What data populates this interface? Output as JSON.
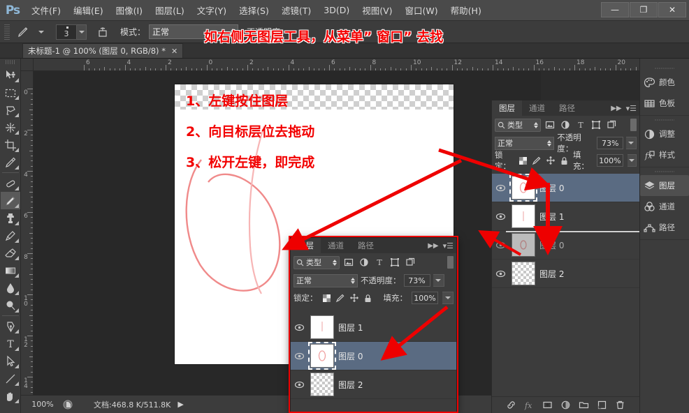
{
  "app": {
    "logo": "Ps"
  },
  "menubar": {
    "items": [
      {
        "label": "文件(F)"
      },
      {
        "label": "编辑(E)"
      },
      {
        "label": "图像(I)"
      },
      {
        "label": "图层(L)"
      },
      {
        "label": "文字(Y)"
      },
      {
        "label": "选择(S)"
      },
      {
        "label": "滤镜(T)"
      },
      {
        "label": "3D(D)"
      },
      {
        "label": "视图(V)"
      },
      {
        "label": "窗口(W)"
      },
      {
        "label": "帮助(H)"
      }
    ],
    "window_controls": [
      {
        "name": "minimize",
        "glyph": "—"
      },
      {
        "name": "maximize",
        "glyph": "❐"
      },
      {
        "name": "close",
        "glyph": "✕"
      }
    ]
  },
  "options_bar": {
    "tool_icon": "pencil-icon",
    "brush_size": "3",
    "mode_label": "模式：",
    "mode_value": "正常",
    "opacity_label": "不透明度："
  },
  "annotations": {
    "top": "如右侧无图层工具，从菜单” 窗口” 去找",
    "steps": [
      "1、左键按住图层",
      "2、向目标层位去拖动",
      "3、松开左键，即完成"
    ]
  },
  "document_tab": {
    "title": "未标题-1 @ 100% (图层 0, RGB/8) *",
    "close_glyph": "✕"
  },
  "toolbar": {
    "tools": [
      {
        "name": "move-tool",
        "selected": false
      },
      {
        "name": "marquee-tool",
        "selected": false
      },
      {
        "name": "lasso-tool",
        "selected": false
      },
      {
        "name": "magic-wand-tool",
        "selected": false
      },
      {
        "name": "crop-tool",
        "selected": false
      },
      {
        "name": "eyedropper-tool",
        "selected": false
      },
      {
        "name": "healing-brush-tool",
        "selected": false
      },
      {
        "name": "pencil-tool",
        "selected": true
      },
      {
        "name": "clone-stamp-tool",
        "selected": false
      },
      {
        "name": "history-brush-tool",
        "selected": false
      },
      {
        "name": "eraser-tool",
        "selected": false
      },
      {
        "name": "gradient-tool",
        "selected": false
      },
      {
        "name": "blur-tool",
        "selected": false
      },
      {
        "name": "dodge-tool",
        "selected": false
      },
      {
        "name": "pen-tool",
        "selected": false
      },
      {
        "name": "type-tool",
        "selected": false
      },
      {
        "name": "path-selection-tool",
        "selected": false
      },
      {
        "name": "line-tool",
        "selected": false
      },
      {
        "name": "hand-tool",
        "selected": false
      }
    ]
  },
  "rulers": {
    "horizontal": [
      "6",
      "4",
      "2",
      "0",
      "2",
      "4",
      "6",
      "8",
      "10",
      "12",
      "14",
      "16",
      "18",
      "20"
    ],
    "vertical": [
      "0",
      "2",
      "4",
      "6",
      "8",
      "10",
      "12",
      "14"
    ]
  },
  "statusbar": {
    "zoom": "100%",
    "doc_label": "文档:",
    "doc_value": "468.8 K/511.8K",
    "arrow": "▶"
  },
  "right_dock": {
    "groups": [
      {
        "items": [
          {
            "label": "颜色",
            "icon": "color-palette-icon",
            "selected": false
          },
          {
            "label": "色板",
            "icon": "swatches-icon",
            "selected": false
          }
        ]
      },
      {
        "items": [
          {
            "label": "调整",
            "icon": "adjustments-icon",
            "selected": false
          },
          {
            "label": "样式",
            "icon": "styles-fx-icon",
            "selected": false
          }
        ]
      },
      {
        "items": [
          {
            "label": "图层",
            "icon": "layers-icon",
            "selected": true
          },
          {
            "label": "通道",
            "icon": "channels-icon",
            "selected": false
          },
          {
            "label": "路径",
            "icon": "paths-icon",
            "selected": false
          }
        ]
      }
    ]
  },
  "layers_panel": {
    "tabs": [
      {
        "label": "图层",
        "selected": true
      },
      {
        "label": "通道",
        "selected": false
      },
      {
        "label": "路径",
        "selected": false
      }
    ],
    "filter_type": "类型",
    "filter_icons": [
      "image-filter-icon",
      "adjustment-filter-icon",
      "type-filter-icon",
      "shape-filter-icon",
      "smartobject-filter-icon"
    ],
    "blend_mode": "正常",
    "opacity_label": "不透明度：",
    "opacity_value": "73%",
    "lock_label": "锁定：",
    "lock_icons": [
      "lock-transparency-icon",
      "lock-image-icon",
      "lock-position-icon",
      "lock-all-icon"
    ],
    "fill_label": "填充：",
    "fill_value": "100%",
    "layers": [
      {
        "name": "图层 0",
        "selected": true,
        "thumb": "white",
        "active_thumb": true
      },
      {
        "name": "图层 1",
        "selected": false,
        "thumb": "white",
        "active_thumb": false
      },
      {
        "name": "图层 0",
        "selected": false,
        "thumb": "white",
        "active_thumb": false,
        "ghost": true
      },
      {
        "name": "图层 2",
        "selected": false,
        "thumb": "checker",
        "active_thumb": false
      }
    ],
    "bottom_icons": [
      "link-layers-icon",
      "fx-icon",
      "add-mask-icon",
      "new-adjustment-icon",
      "new-group-icon",
      "new-layer-icon",
      "delete-layer-icon"
    ]
  },
  "floating_panel": {
    "tabs": [
      {
        "label": "图层",
        "selected": true
      },
      {
        "label": "通道",
        "selected": false
      },
      {
        "label": "路径",
        "selected": false
      }
    ],
    "filter_type": "类型",
    "blend_mode": "正常",
    "opacity_label": "不透明度：",
    "opacity_value": "73%",
    "lock_label": "锁定：",
    "fill_label": "填充：",
    "fill_value": "100%",
    "layers": [
      {
        "name": "图层 1",
        "selected": false,
        "thumb": "white",
        "active_thumb": false
      },
      {
        "name": "图层 0",
        "selected": true,
        "thumb": "white",
        "active_thumb": true
      },
      {
        "name": "图层 2",
        "selected": false,
        "thumb": "checker",
        "active_thumb": false
      }
    ]
  },
  "colors": {
    "annotation_red": "#f20000",
    "selection_blue": "#5a6b82",
    "panel_bg": "#3c3c3c",
    "menubar_bg": "#4a4a4a",
    "logo_blue": "#8fb8d8"
  }
}
